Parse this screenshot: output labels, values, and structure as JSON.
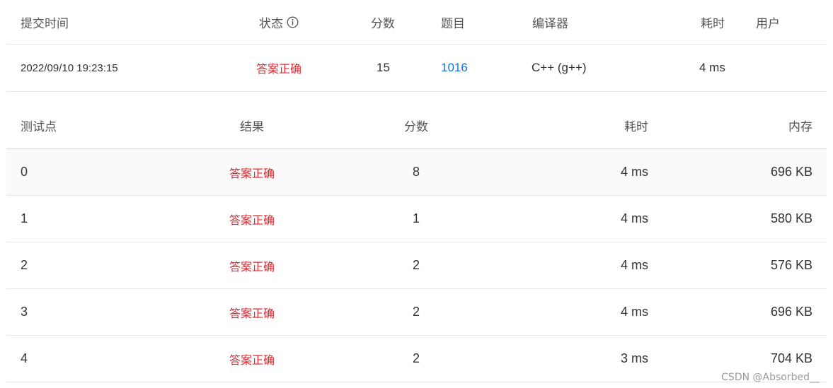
{
  "summary": {
    "headers": {
      "submit_time": "提交时间",
      "status": "状态",
      "score": "分数",
      "problem": "题目",
      "compiler": "编译器",
      "time_used": "耗时",
      "user": "用户"
    },
    "row": {
      "submit_time": "2022/09/10 19:23:15",
      "status": "答案正确",
      "score": "15",
      "problem": "1016",
      "compiler": "C++ (g++)",
      "time_used": "4 ms",
      "user": ""
    }
  },
  "cases": {
    "headers": {
      "case": "测试点",
      "result": "结果",
      "score": "分数",
      "time_used": "耗时",
      "memory": "内存"
    },
    "rows": [
      {
        "case": "0",
        "result": "答案正确",
        "score": "8",
        "time_used": "4 ms",
        "memory": "696 KB"
      },
      {
        "case": "1",
        "result": "答案正确",
        "score": "1",
        "time_used": "4 ms",
        "memory": "580 KB"
      },
      {
        "case": "2",
        "result": "答案正确",
        "score": "2",
        "time_used": "4 ms",
        "memory": "576 KB"
      },
      {
        "case": "3",
        "result": "答案正确",
        "score": "2",
        "time_used": "4 ms",
        "memory": "696 KB"
      },
      {
        "case": "4",
        "result": "答案正确",
        "score": "2",
        "time_used": "3 ms",
        "memory": "704 KB"
      }
    ]
  },
  "watermark": "CSDN @Absorbed__",
  "colors": {
    "accepted": "#e5232b",
    "link": "#1a73d9",
    "border": "#e8e8e8"
  },
  "icons": {
    "status_info": "info-circle-icon"
  }
}
